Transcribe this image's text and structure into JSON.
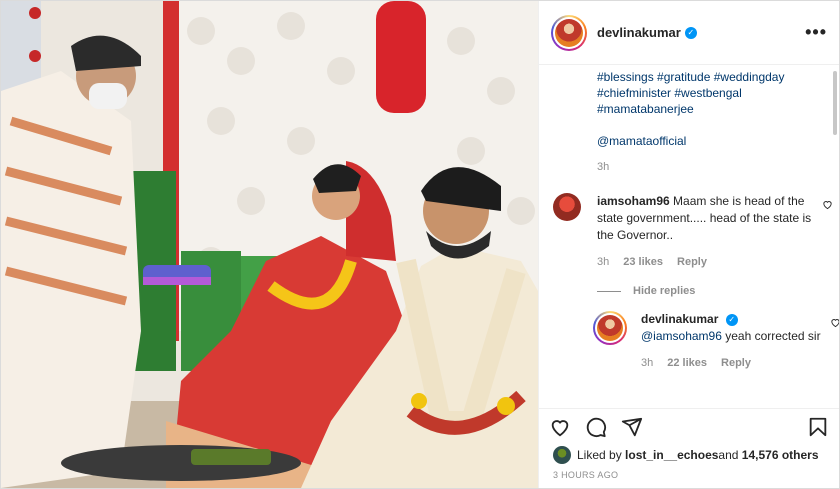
{
  "post": {
    "username": "devlinakumar",
    "verified_mark": "✓",
    "more_icon": "•••",
    "caption_tags": [
      "#blessings #gratitude #weddingday",
      "#chiefminister #westbengal",
      "#mamatabanerjee"
    ],
    "caption_mention": "@mamataofficial",
    "caption_time": "3h"
  },
  "comments": [
    {
      "username": "iamsoham96",
      "text": "Maam she is head of the state government..... head of the state is the Governor..",
      "time": "3h",
      "likes": "23 likes",
      "reply_label": "Reply"
    }
  ],
  "hide_replies": "Hide replies",
  "reply": {
    "username": "devlinakumar",
    "mention": "@iamsoham96",
    "text": " yeah corrected sir",
    "time": "3h",
    "likes": "22 likes",
    "reply_label": "Reply"
  },
  "likes_line": {
    "prefix": "Liked by ",
    "user": "lost_in__echoes",
    "middle": " and ",
    "others": "14,576 others"
  },
  "timestamp": "3 HOURS AGO",
  "icons": [
    "heart-icon",
    "comment-icon",
    "share-icon",
    "bookmark-icon",
    "verified-icon",
    "more-icon"
  ],
  "colors": {
    "link": "#00376b",
    "verified": "#0095f6",
    "muted": "#8e8e8e"
  }
}
